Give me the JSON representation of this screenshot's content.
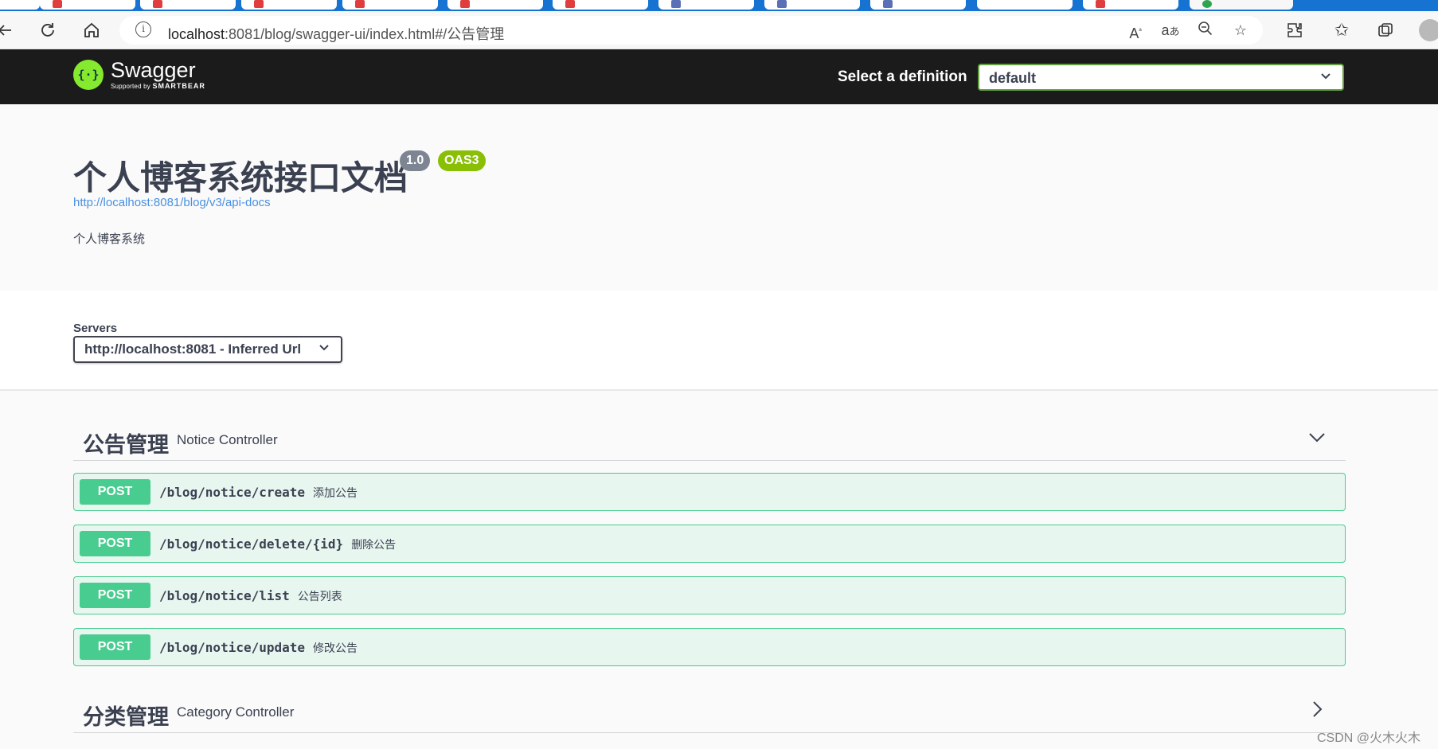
{
  "browser": {
    "url_host": "localhost",
    "url_rest": ":8081/blog/swagger-ui/index.html#/公告管理",
    "icons": [
      "back-icon",
      "refresh-icon",
      "home-icon",
      "site-info-icon",
      "read-aloud-icon",
      "translate-icon",
      "zoom-out-icon",
      "favorite-add-icon",
      "extensions-icon",
      "favorites-icon",
      "collections-icon",
      "profile-icon"
    ]
  },
  "topbar": {
    "logo_name": "Swagger",
    "logo_sub_prefix": "Supported by",
    "logo_sub_brand": "SMARTBEAR",
    "definition_label": "Select a definition",
    "definition_value": "default"
  },
  "info": {
    "title": "个人博客系统接口文档",
    "version": "1.0",
    "oas": "OAS3",
    "api_docs_url": "http://localhost:8081/blog/v3/api-docs",
    "description": "个人博客系统"
  },
  "servers": {
    "label": "Servers",
    "selected": "http://localhost:8081 - Inferred Url"
  },
  "tags": [
    {
      "name": "公告管理",
      "description": "Notice Controller",
      "expanded": true,
      "operations": [
        {
          "method": "POST",
          "path": "/blog/notice/create",
          "summary": "添加公告"
        },
        {
          "method": "POST",
          "path": "/blog/notice/delete/{id}",
          "summary": "删除公告"
        },
        {
          "method": "POST",
          "path": "/blog/notice/list",
          "summary": "公告列表"
        },
        {
          "method": "POST",
          "path": "/blog/notice/update",
          "summary": "修改公告"
        }
      ]
    },
    {
      "name": "分类管理",
      "description": "Category Controller",
      "expanded": false
    }
  ],
  "watermark": "CSDN @火木火木",
  "colors": {
    "post": "#49cc90",
    "post_bg": "#e8f6f0",
    "topbar": "#1b1b1b",
    "swagger_green": "#85ea2d",
    "oas_badge": "#89bf04",
    "version_badge": "#7d8492",
    "link": "#4990e2"
  }
}
